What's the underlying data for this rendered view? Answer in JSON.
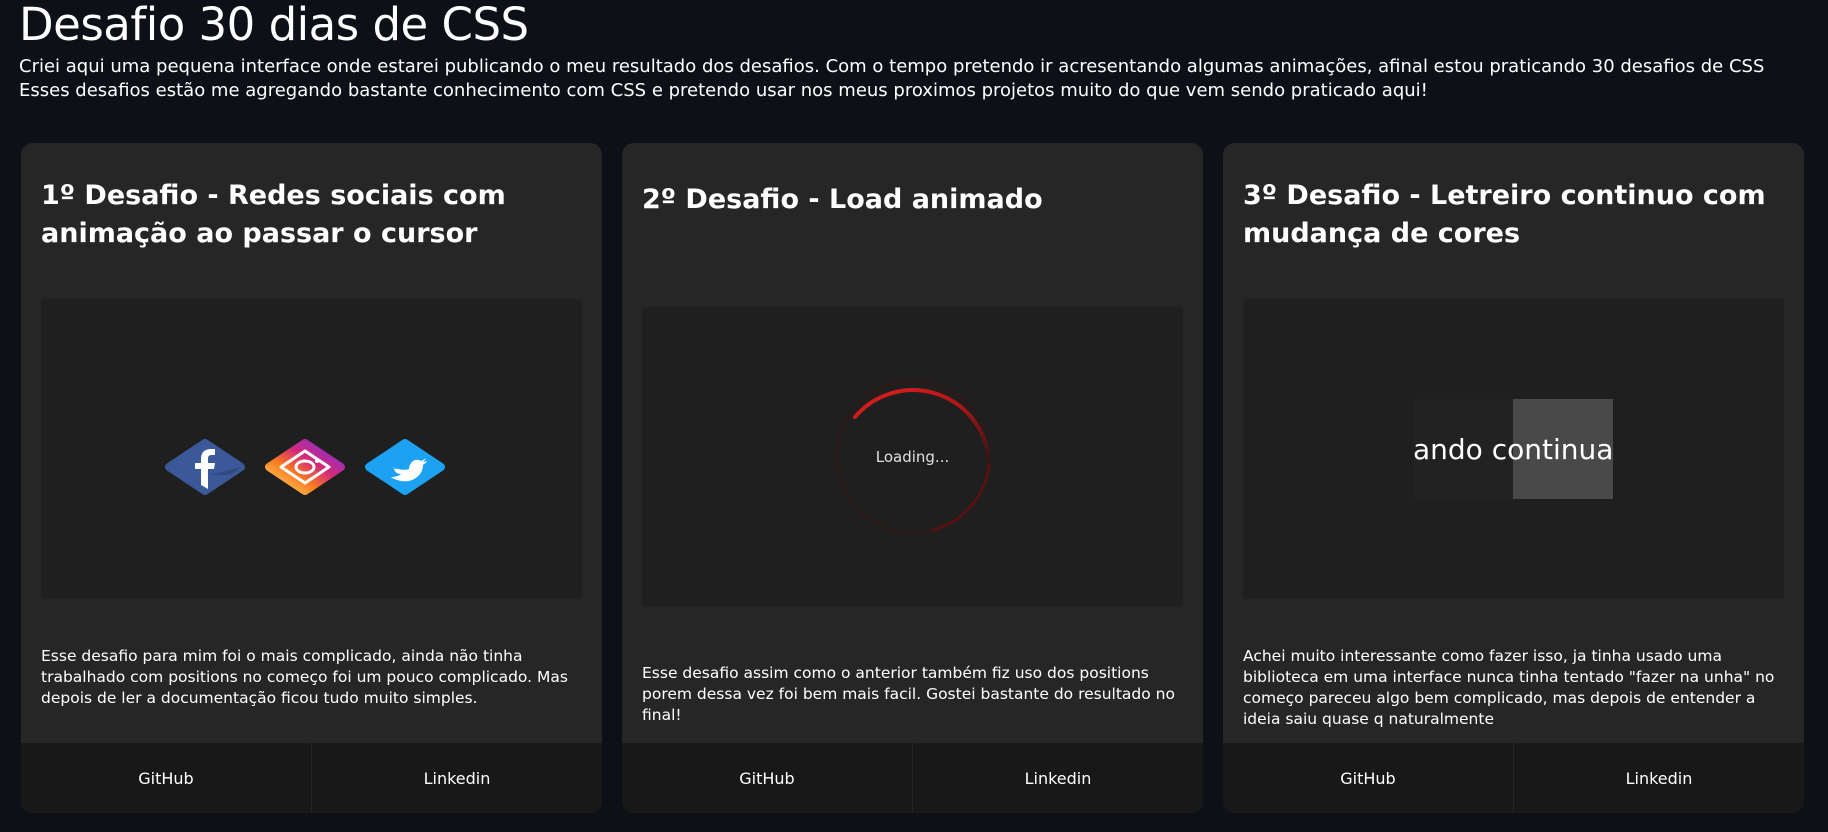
{
  "header": {
    "title": "Desafio 30 dias de CSS",
    "intro_line1": "Criei aqui uma pequena interface onde estarei publicando o meu resultado dos desafios. Com o tempo pretendo ir acresentando algumas animações, afinal estou praticando 30 desafios de CSS",
    "intro_line2": "Esses desafios estão me agregando bastante conhecimento com CSS e pretendo usar nos meus proximos projetos muito do que vem sendo praticado aqui!"
  },
  "cards": [
    {
      "title": "1º Desafio - Redes sociais com animação ao passar o cursor",
      "description": "Esse desafio para mim foi o mais complicado, ainda não tinha trabalhado com positions no começo foi um pouco complicado. Mas depois de ler a documentação ficou tudo muito simples.",
      "github_label": "GitHub",
      "linkedin_label": "Linkedin",
      "icons": [
        "facebook-icon",
        "instagram-icon",
        "twitter-icon"
      ]
    },
    {
      "title": "2º Desafio - Load animado",
      "description": "Esse desafio assim como o anterior também fiz uso dos positions porem dessa vez foi bem mais facil. Gostei bastante do resultado no final!",
      "loader_text": "Loading...",
      "github_label": "GitHub",
      "linkedin_label": "Linkedin"
    },
    {
      "title": "3º Desafio - Letreiro continuo com mudança de cores",
      "description": "Achei muito interessante como fazer isso, ja tinha usado uma biblioteca em uma interface nunca tinha tentado \"fazer na unha\" no começo pareceu algo bem complicado, mas depois de entender a ideia saiu quase q naturalmente",
      "marquee_text": "ando continua",
      "github_label": "GitHub",
      "linkedin_label": "Linkedin"
    }
  ],
  "colors": {
    "background": "#0d1117",
    "card": "#262626",
    "demo_box": "#1f1f1f",
    "footer": "#181818",
    "loader_accent": "#d81b1b",
    "facebook": "#3b5998",
    "twitter": "#1da1f2"
  }
}
